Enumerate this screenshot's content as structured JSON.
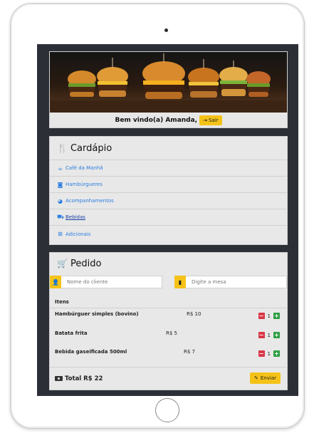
{
  "header": {
    "welcome": "Bem vindo(a) Amanda,",
    "logout_label": "Sair"
  },
  "menu": {
    "title": "Cardápio",
    "items": [
      {
        "label": "Café da Manhã",
        "icon": "coffee-icon"
      },
      {
        "label": "Hambúrgueres",
        "icon": "burger-icon"
      },
      {
        "label": "Acompanhamentos",
        "icon": "pie-icon"
      },
      {
        "label": "Bebidas",
        "icon": "car-icon",
        "active": true
      },
      {
        "label": "Adicionais",
        "icon": "plus-square-icon"
      }
    ]
  },
  "order": {
    "title": "Pedido",
    "customer_placeholder": "Nome do cliente",
    "table_placeholder": "Digite a mesa",
    "items_header": "Itens",
    "rows": [
      {
        "name": "Hambúrguer simples (bovino)",
        "price": "R$ 10",
        "qty": "1"
      },
      {
        "name": "Batata frita",
        "price": "R$ 5",
        "qty": "1"
      },
      {
        "name": "Bebida gaseificada 500ml",
        "price": "R$ 7",
        "qty": "1"
      }
    ],
    "total": "Total R$ 22",
    "send_label": "Enviar"
  },
  "colors": {
    "accent": "#f5c218",
    "link": "#2a7de1",
    "danger": "#d93848",
    "success": "#2f9e44",
    "screen_bg": "#2c3036"
  }
}
